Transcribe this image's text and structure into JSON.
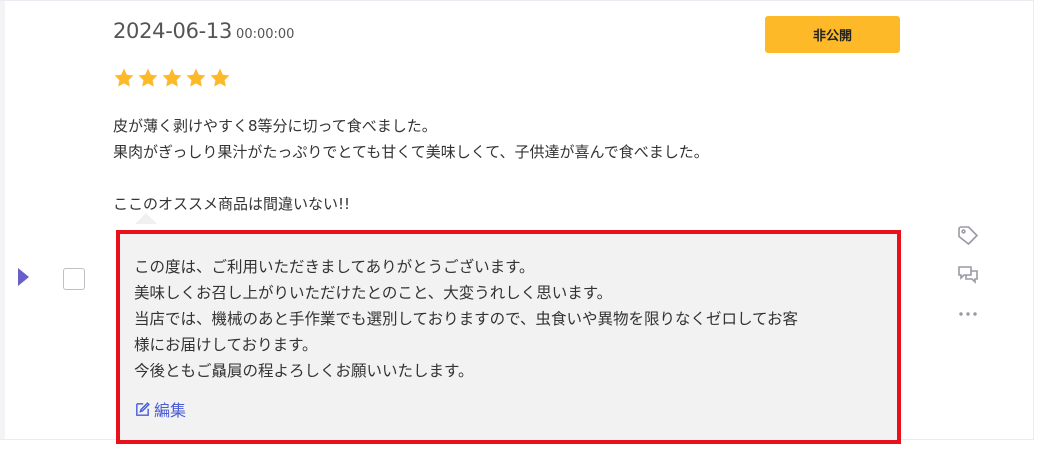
{
  "review": {
    "date": "2024-06-13",
    "time": "00:00:00",
    "status_button": "非公開",
    "rating": 5,
    "rating_max": 5,
    "star_color": "#fdb927",
    "lines": [
      "皮が薄く剥けやすく8等分に切って食べました。",
      "果肉がぎっしり果汁がたっぷりでとても甘くて美味しくて、子供達が喜んで食べました。",
      "",
      "ここのオススメ商品は間違いない!!"
    ]
  },
  "reply": {
    "lines": [
      "この度は、ご利用いただきましてありがとうございます。",
      "美味しくお召し上がりいただけたとのこと、大変うれしく思います。",
      "当店では、機械のあと手作業でも選別しておりますので、虫食いや異物を限りなくゼロしてお客",
      "様にお届けしております。",
      "今後ともご贔屓の程よろしくお願いいたします。"
    ],
    "edit_label": "編集",
    "highlight_color": "#e8111b"
  },
  "side_actions": {
    "icons": [
      "tag-icon",
      "comment-icon",
      "more-icon"
    ]
  },
  "colors": {
    "accent": "#6a5fc9",
    "button": "#fdb927",
    "link": "#4a5bd6"
  }
}
